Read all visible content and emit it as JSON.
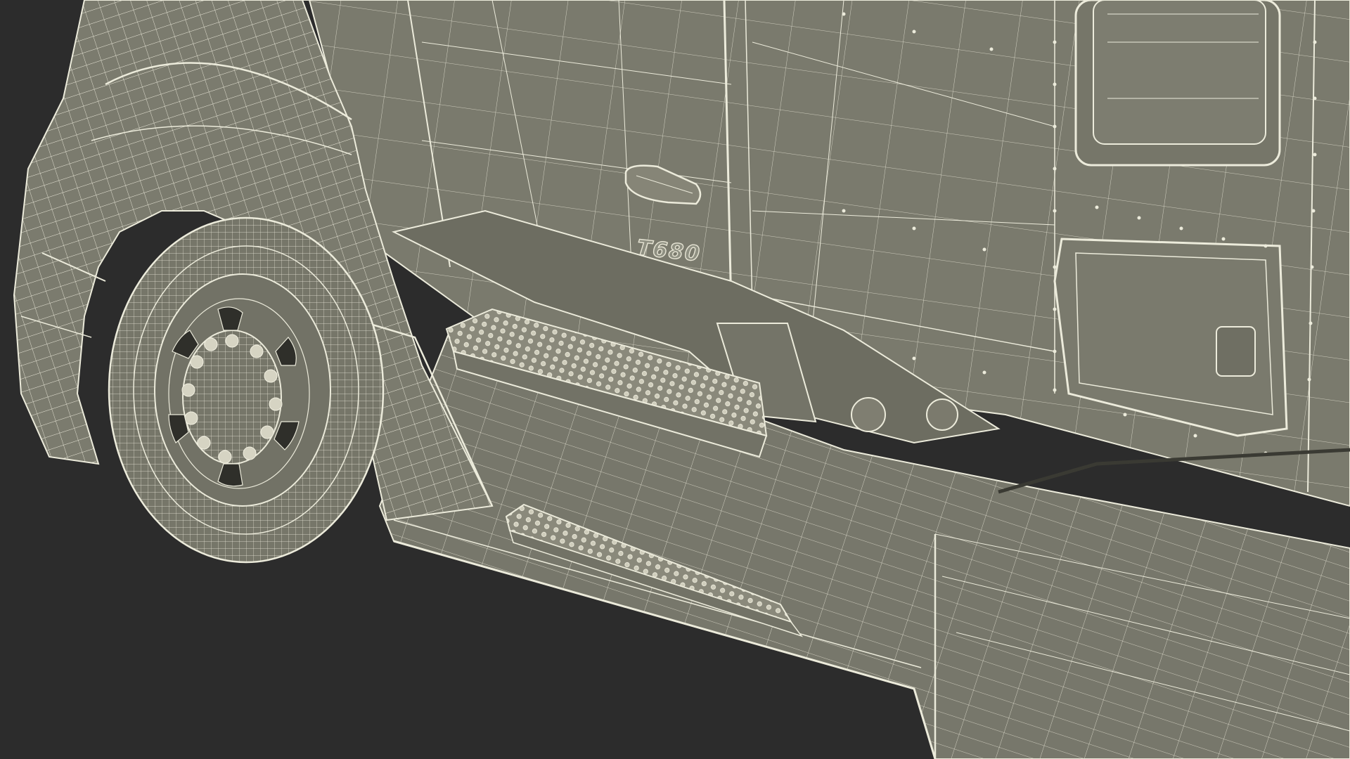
{
  "scene": {
    "background": "#2c2c2c",
    "surface_color": "#7a7a6d",
    "wire_color": "#e8e6d6",
    "badge": "T680"
  }
}
